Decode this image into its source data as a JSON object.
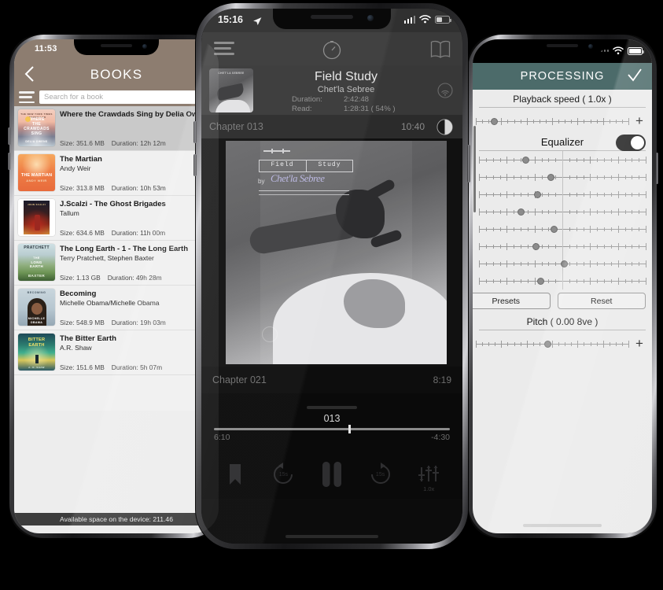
{
  "left_phone": {
    "status_time": "11:53",
    "nav": {
      "back_icon": "chevron-left-icon",
      "title": "BOOKS"
    },
    "search": {
      "placeholder": "Search for a book",
      "value": "",
      "menu_icon": "hamburger-icon"
    },
    "books": [
      {
        "title": "Where the Crawdads Sing by Delia Owens",
        "author": "",
        "size_label": "Size: 351.6 MB",
        "duration_label": "Duration: 12h 12m",
        "selected": true
      },
      {
        "title": "The Martian",
        "author": "Andy Weir",
        "size_label": "Size: 313.8 MB",
        "duration_label": "Duration: 10h 53m",
        "selected": false
      },
      {
        "title": "J.Scalzi - The Ghost Brigades",
        "author": "Tallum",
        "size_label": "Size: 634.6 MB",
        "duration_label": "Duration: 11h 00m",
        "selected": false
      },
      {
        "title": "The Long Earth - 1 - The Long Earth",
        "author": "Terry Pratchett, Stephen Baxter",
        "size_label": "Size: 1.13 GB",
        "duration_label": "Duration: 49h 28m",
        "selected": false
      },
      {
        "title": "Becoming",
        "author": "Michelle Obama/Michelle Obama",
        "size_label": "Size: 548.9 MB",
        "duration_label": "Duration: 19h 03m",
        "selected": false
      },
      {
        "title": "The Bitter Earth",
        "author": "A.R. Shaw",
        "size_label": "Size: 151.6 MB",
        "duration_label": "Duration: 5h 07m",
        "selected": false
      }
    ],
    "footer": "Available space on the device: 211.46"
  },
  "center_phone": {
    "status_time": "15:16",
    "status_icons": {
      "location": "location-arrow-icon",
      "cellular": "signal-bars-icon",
      "wifi": "wifi-icon",
      "battery": "battery-icon"
    },
    "toolbar": {
      "menu_icon": "hamburger-icon",
      "timer_icon": "sleep-timer-icon",
      "book_icon": "open-book-icon"
    },
    "now_playing": {
      "title": "Field Study",
      "author": "Chet'la Sebree",
      "duration_label": "Duration:",
      "duration_value": "2:42:48",
      "read_label": "Read:",
      "read_value": "1:28:31 ( 54% )",
      "airplay_icon": "airplay-icon"
    },
    "cover": {
      "title_left": "Field",
      "title_right": "Study",
      "byline": "by",
      "signature": "Chet'la Sebree"
    },
    "chapter_above": {
      "name": "Chapter 013",
      "time": "10:40"
    },
    "chapter_below": {
      "name": "Chapter 021",
      "time": "8:19"
    },
    "seek": {
      "current_chapter": "013",
      "elapsed": "6:10",
      "remaining": "-4:30",
      "progress_pct": 57
    },
    "controls": [
      {
        "name": "bookmark-button",
        "label": ""
      },
      {
        "name": "rewind-15-button",
        "label": "15s"
      },
      {
        "name": "pause-button",
        "label": ""
      },
      {
        "name": "forward-15-button",
        "label": "15s"
      },
      {
        "name": "equalizer-button",
        "label": "1.0x"
      }
    ]
  },
  "right_phone": {
    "status_icons": {
      "wifi": "wifi-icon",
      "battery": "battery-icon"
    },
    "nav": {
      "title": "PROCESSING",
      "confirm_icon": "checkmark-icon"
    },
    "playback_speed": {
      "label": "Playback speed ( 1.0x )",
      "plus_label": "+",
      "knob_pct": 12
    },
    "equalizer": {
      "label": "Equalizer",
      "enabled": true
    },
    "eq_bands": [
      {
        "knob_pct": 28
      },
      {
        "knob_pct": 43
      },
      {
        "knob_pct": 35
      },
      {
        "knob_pct": 25
      },
      {
        "knob_pct": 45
      },
      {
        "knob_pct": 34
      },
      {
        "knob_pct": 51
      },
      {
        "knob_pct": 37
      }
    ],
    "buttons": {
      "presets": "Presets",
      "reset": "Reset"
    },
    "pitch": {
      "label": "Pitch ( 0.00 8ve )",
      "plus_label": "+",
      "knob_pct": 47
    }
  }
}
